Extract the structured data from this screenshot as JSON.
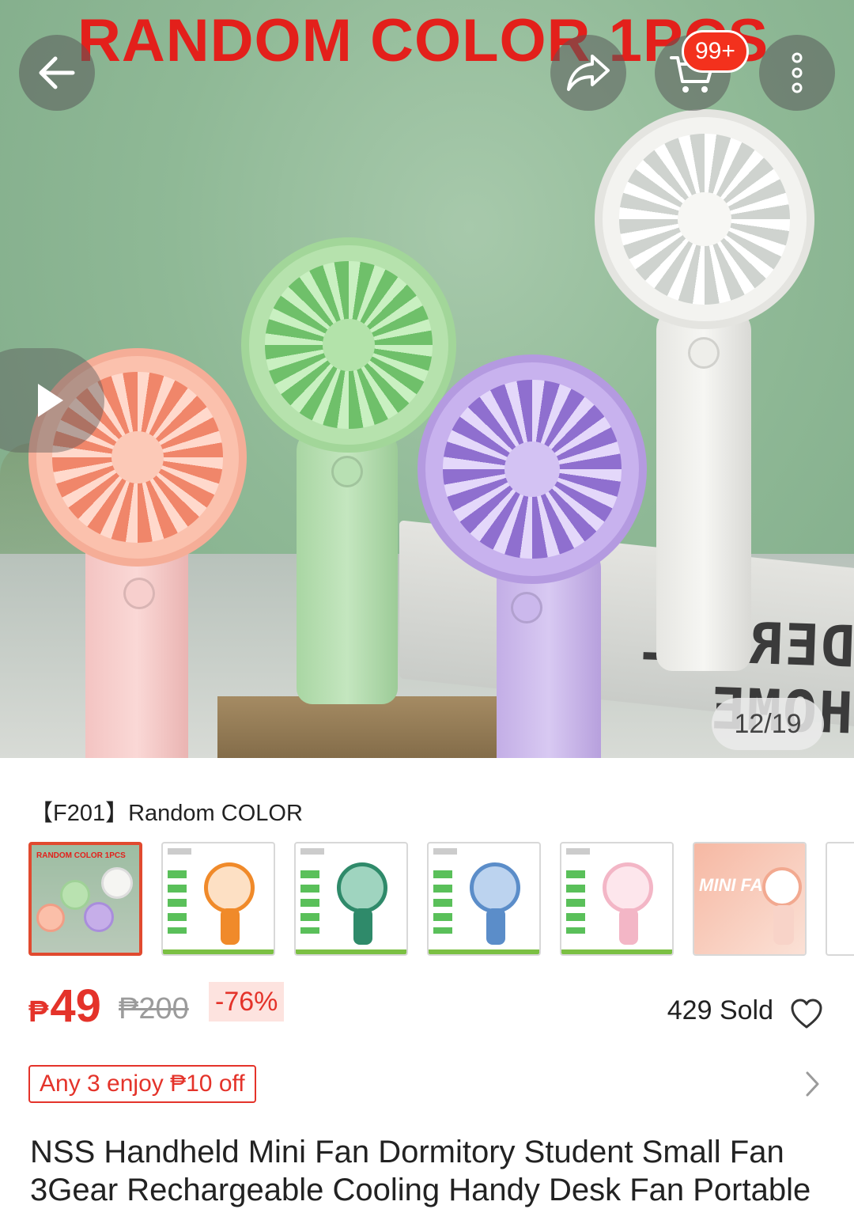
{
  "hero": {
    "banner_text": "RANDOM COLOR 1PCS",
    "cart_badge": "99+",
    "image_counter": "12/19",
    "book_text": "DERFUL HOME"
  },
  "icons": {
    "back": "back-arrow-icon",
    "share": "share-icon",
    "cart": "cart-icon",
    "more": "more-vertical-icon",
    "play": "play-icon",
    "favorite": "heart-outline-icon",
    "chevron": "chevron-right-icon"
  },
  "variant": {
    "selected_label": "【F201】Random COLOR",
    "thumbnails": [
      {
        "id": "random-color",
        "label": "RANDOM COLOR 1PCS"
      },
      {
        "id": "orange",
        "color": "#f08a2a"
      },
      {
        "id": "green",
        "color": "#2f8a6a"
      },
      {
        "id": "blue",
        "color": "#5b8dc9"
      },
      {
        "id": "pink",
        "color": "#f3b6c6"
      },
      {
        "id": "mini-fan",
        "label": "MINI FAN"
      }
    ]
  },
  "price": {
    "currency": "₱",
    "current": "49",
    "original": "₱200",
    "discount": "-76%",
    "sold": "429 Sold"
  },
  "promo": {
    "label": "Any 3 enjoy ₱10 off"
  },
  "product": {
    "title": "NSS Handheld Mini Fan Dormitory Student Small Fan 3Gear Rechargeable Cooling Handy Desk Fan Portable"
  },
  "colors": {
    "accent": "#e4332a",
    "badge": "#f3311d",
    "banner_red": "#e3201b",
    "discount_bg": "#fde3df"
  }
}
